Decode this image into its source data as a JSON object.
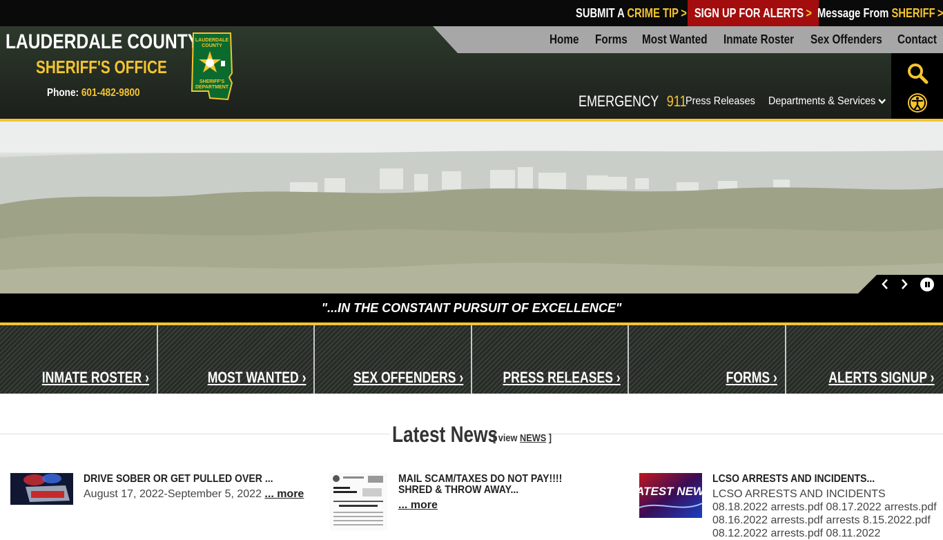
{
  "topbar": {
    "crime_tip": {
      "prefix": "SUBMIT A",
      "accent": "CRIME TIP"
    },
    "alerts": {
      "label": "SIGN UP FOR ALERTS"
    },
    "message": {
      "prefix": "Message From",
      "accent": "SHERIFF"
    },
    "chevron": ">"
  },
  "brand": {
    "title": "LAUDERDALE COUNTY",
    "subtitle": "SHERIFF'S OFFICE",
    "phone_label": "Phone:",
    "phone_number": "601-482-9800",
    "badge_top": "LAUDERDALE",
    "badge_top2": "COUNTY",
    "badge_bottom": "SHERIFF'S",
    "badge_bottom2": "DEPARTMENT"
  },
  "nav": {
    "items": [
      "Home",
      "Forms",
      "Most Wanted",
      "Inmate Roster",
      "Sex Offenders",
      "Contact"
    ],
    "emergency_label": "EMERGENCY",
    "emergency_number": "911",
    "press_releases": "Press Releases",
    "departments": "Departments & Services"
  },
  "hero": {
    "motto": "\"...IN THE CONSTANT PURSUIT OF EXCELLENCE\"",
    "prev": "‹",
    "next": "›"
  },
  "quick_links": [
    {
      "label": "INMATE ROSTER"
    },
    {
      "label": "MOST WANTED"
    },
    {
      "label": "SEX OFFENDERS"
    },
    {
      "label": "PRESS RELEASES"
    },
    {
      "label": "FORMS"
    },
    {
      "label": "ALERTS SIGNUP"
    }
  ],
  "news": {
    "title": "Latest News",
    "view_prefix": "[ view",
    "view_link": "NEWS",
    "view_suffix": "]",
    "more_label": "... more",
    "items": [
      {
        "title": "DRIVE SOBER OR GET PULLED OVER ...",
        "text": "August 17, 2022-September 5, 2022"
      },
      {
        "title": "MAIL SCAM/TAXES DO NOT PAY!!!! SHRED & THROW AWAY...",
        "text": ""
      },
      {
        "title": "LCSO ARRESTS AND INCIDENTS...",
        "text": "LCSO ARRESTS AND INCIDENTS 08.18.2022 arrests.pdf 08.17.2022 arrests.pdf 08.16.2022 arrests.pdf arrests 8.15.2022.pdf 08.12.2022 arrests.pdf 08.11.2022"
      }
    ],
    "thumb3_text": "LATEST NEWS"
  },
  "colors": {
    "accent": "#f4c430",
    "alert_red": "#a40d0d",
    "header_green": "#2d3a2c"
  }
}
